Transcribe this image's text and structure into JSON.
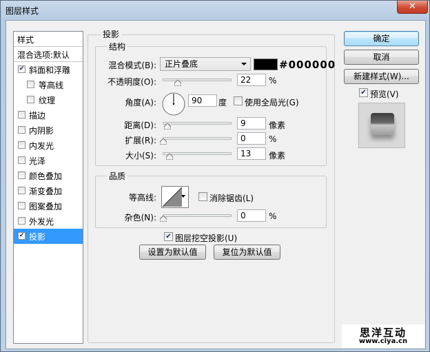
{
  "window": {
    "title": "图层样式",
    "close_glyph": "✕"
  },
  "styles_list": {
    "header": "样式",
    "items": [
      {
        "label": "混合选项:默认",
        "checkbox": false,
        "checked": false
      },
      {
        "label": "斜面和浮雕",
        "checkbox": true,
        "checked": true
      },
      {
        "label": "等高线",
        "checkbox": true,
        "checked": false
      },
      {
        "label": "纹理",
        "checkbox": true,
        "checked": false
      },
      {
        "label": "描边",
        "checkbox": true,
        "checked": false
      },
      {
        "label": "内阴影",
        "checkbox": true,
        "checked": false
      },
      {
        "label": "内发光",
        "checkbox": true,
        "checked": false
      },
      {
        "label": "光泽",
        "checkbox": true,
        "checked": false
      },
      {
        "label": "颜色叠加",
        "checkbox": true,
        "checked": false
      },
      {
        "label": "渐变叠加",
        "checkbox": true,
        "checked": false
      },
      {
        "label": "图案叠加",
        "checkbox": true,
        "checked": false
      },
      {
        "label": "外发光",
        "checkbox": true,
        "checked": false
      },
      {
        "label": "投影",
        "checkbox": true,
        "checked": true,
        "selected": true
      }
    ]
  },
  "drop_shadow": {
    "section_title": "投影",
    "structure": {
      "title": "结构",
      "blend_mode_label": "混合模式(B):",
      "blend_mode_value": "正片叠底",
      "color_hex": "#000000",
      "opacity_label": "不透明度(O):",
      "opacity_value": "22",
      "opacity_unit": "%",
      "angle_label": "角度(A):",
      "angle_value": "90",
      "angle_unit": "度",
      "global_light_label": "使用全局光(G)",
      "global_light_checked": false,
      "distance_label": "距离(D):",
      "distance_value": "9",
      "distance_unit": "像素",
      "spread_label": "扩展(R):",
      "spread_value": "0",
      "spread_unit": "%",
      "size_label": "大小(S):",
      "size_value": "13",
      "size_unit": "像素"
    },
    "quality": {
      "title": "品质",
      "contour_label": "等高线:",
      "anti_alias_label": "消除锯齿(L)",
      "anti_alias_checked": false,
      "noise_label": "杂色(N):",
      "noise_value": "0",
      "noise_unit": "%"
    },
    "knockout_label": "图层挖空投影(U)",
    "knockout_checked": true,
    "make_default_label": "设置为默认值",
    "reset_default_label": "复位为默认值"
  },
  "buttons": {
    "ok": "确定",
    "cancel": "取消",
    "new_style": "新建样式(W)...",
    "preview_label": "预览(V)",
    "preview_checked": true
  },
  "watermark": {
    "title": "思洋互动",
    "url": "www.ciya.cn"
  },
  "check_glyph": "✔"
}
